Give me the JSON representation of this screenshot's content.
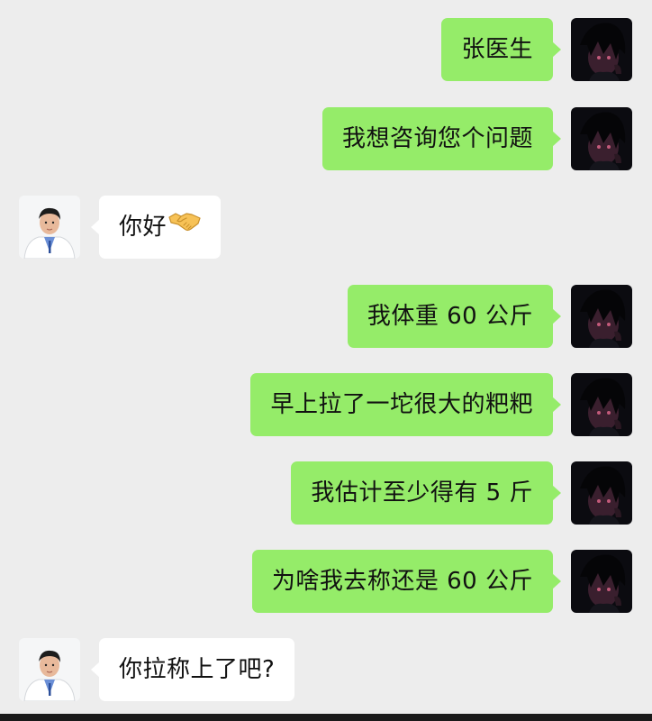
{
  "messages": [
    {
      "sender": "me",
      "text": "张医生"
    },
    {
      "sender": "me",
      "text": "我想咨询您个问题"
    },
    {
      "sender": "doctor",
      "text": "你好",
      "emoji": "handshake-emoji"
    },
    {
      "sender": "me",
      "text": "我体重 60 公斤"
    },
    {
      "sender": "me",
      "text": "早上拉了一坨很大的粑粑"
    },
    {
      "sender": "me",
      "text": "我估计至少得有 5 斤"
    },
    {
      "sender": "me",
      "text": "为啥我去称还是 60 公斤"
    },
    {
      "sender": "doctor",
      "text": "你拉称上了吧?"
    }
  ],
  "colors": {
    "background": "#ededed",
    "my_bubble": "#95ec69",
    "their_bubble": "#ffffff"
  }
}
